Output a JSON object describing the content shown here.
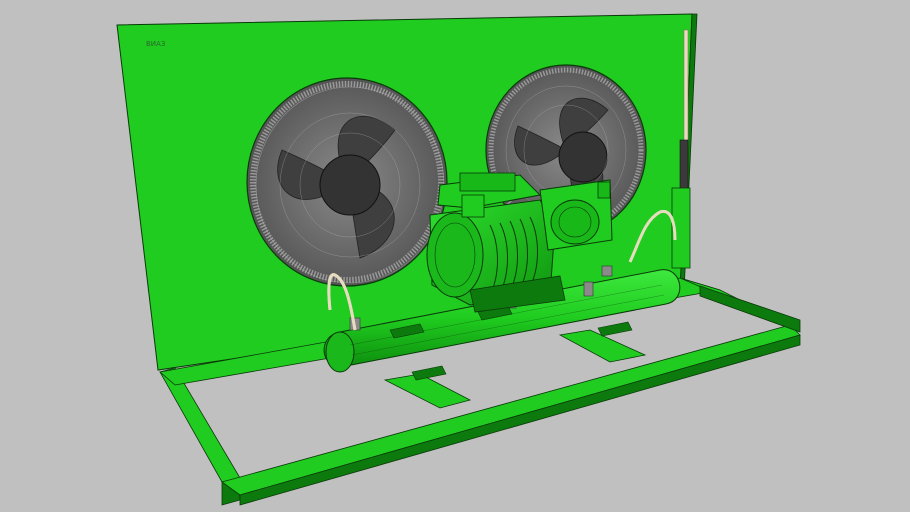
{
  "scene": {
    "background": "#c0c0c0",
    "subject": "condensing-unit-3d-model",
    "colors": {
      "body_green": "#1fcc1f",
      "dark_green": "#0c7a0c",
      "line_dark": "#0a3a0a",
      "fan_gray": "#6e6e6e",
      "fan_dark": "#3a3a3a",
      "copper_pipe": "#e8dcc0",
      "grille_line": "#9a9a9a"
    },
    "panel_label": "ВИАЗ"
  }
}
